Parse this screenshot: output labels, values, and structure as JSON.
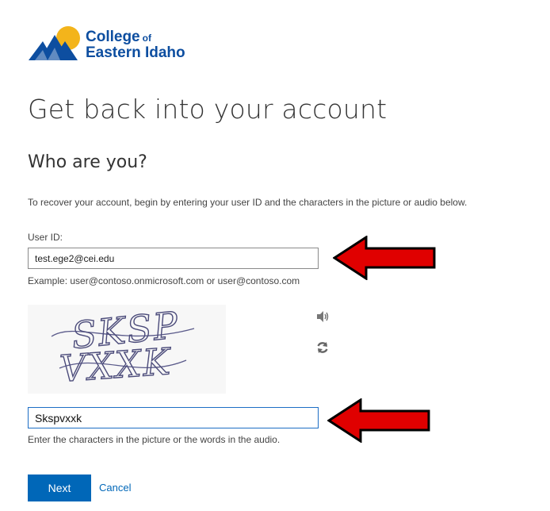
{
  "brand": {
    "line1": "College",
    "line1_suffix": "of",
    "line2": "Eastern Idaho",
    "color_blue": "#0d4ea0",
    "color_gold": "#f3b41b"
  },
  "page": {
    "title": "Get back into your account",
    "subtitle": "Who are you?",
    "intro": "To recover your account, begin by entering your user ID and the characters in the picture or audio below."
  },
  "user_id": {
    "label": "User ID:",
    "value": "test.ege2@cei.edu",
    "example": "Example: user@contoso.onmicrosoft.com or user@contoso.com"
  },
  "captcha": {
    "line1": "SKSP",
    "line2": "VXXK",
    "speaker_icon": "speaker-icon",
    "refresh_icon": "refresh-icon",
    "input_value": "Skspvxxk",
    "help": "Enter the characters in the picture or the words in the audio."
  },
  "actions": {
    "next_label": "Next",
    "cancel_label": "Cancel",
    "accent": "#0067b8"
  },
  "annotations": {
    "arrow_color": "#e00000",
    "arrow_icon": "red-arrow-left"
  }
}
